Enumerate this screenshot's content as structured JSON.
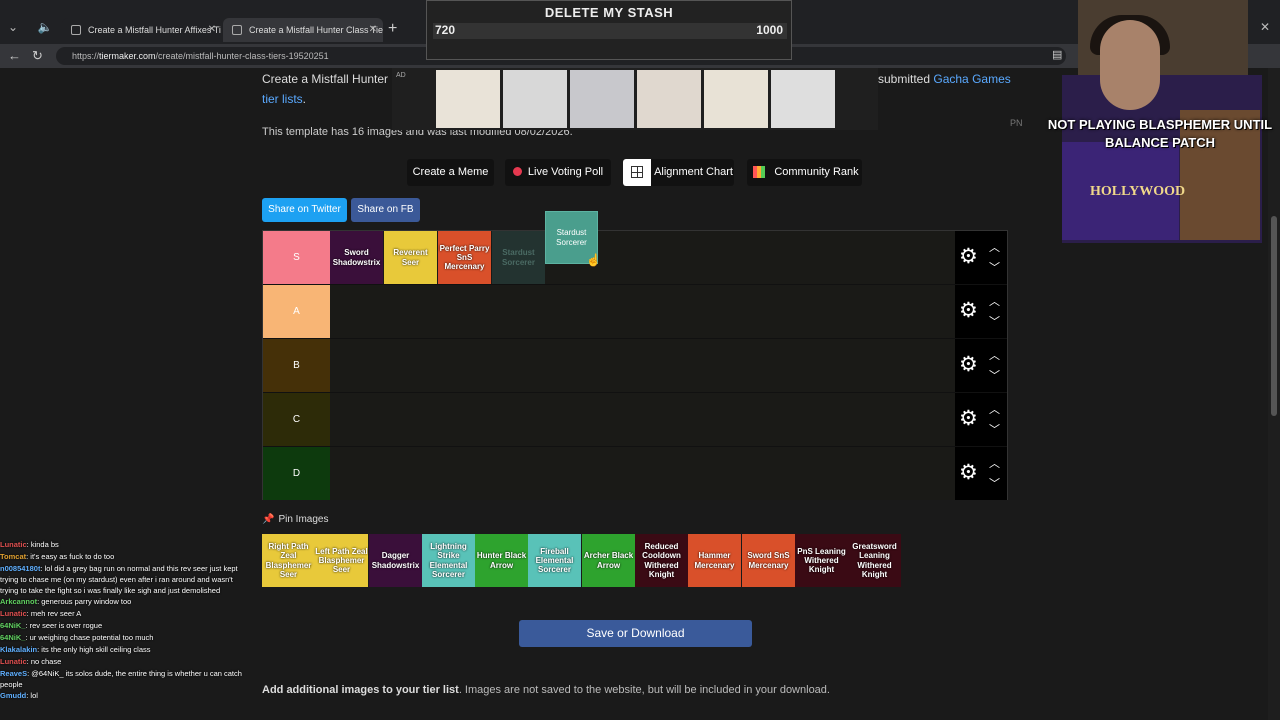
{
  "browser": {
    "tabs": [
      {
        "title": "Create a Mistfall Hunter Affixes Ti",
        "active": false
      },
      {
        "title": "Create a Mistfall Hunter Class Tie",
        "active": true
      }
    ],
    "url_prefix": "https://",
    "url_domain": "tiermaker.com",
    "url_path": "/create/mistfall-hunter-class-tiers-19520251"
  },
  "page": {
    "intro_text": "Create a Mistfall Hunter C",
    "submitted_text": "submitted",
    "category_link": "Gacha Games",
    "tier_lists_link": "tier lists",
    "template_info": "This template has 16 images and was last modified 08/02/2026.",
    "ad_label": "AD",
    "pn_label": "PN",
    "buttons": {
      "create_meme": "Create a Meme",
      "live_voting": "Live Voting Poll",
      "alignment_chart": "Alignment Chart",
      "community_rank": "Community Rank"
    },
    "share": {
      "twitter": "Share on Twitter",
      "facebook": "Share on FB"
    },
    "tiers": [
      {
        "label": "S",
        "color": "#f47b8a"
      },
      {
        "label": "A",
        "color": "#f8b575"
      },
      {
        "label": "B",
        "color": "#453008"
      },
      {
        "label": "C",
        "color": "#2d2b08"
      },
      {
        "label": "D",
        "color": "#0d3a0d"
      }
    ],
    "s_tier_items": [
      {
        "label": "Sword Shadowstrix",
        "color": "#3a0f3a"
      },
      {
        "label": "Reverent Seer",
        "color": "#e8c93a"
      },
      {
        "label": "Perfect Parry SnS Mercenary",
        "color": "#d9502a"
      },
      {
        "label": "Stardust Sorcerer",
        "color": "#233330"
      }
    ],
    "dragging_item": "Stardust Sorcerer",
    "pin_images": "Pin Images",
    "pool_items": [
      {
        "label": "Right Path Zeal Blasphemer Seer",
        "color": "#e8c93a"
      },
      {
        "label": "Left Path Zeal Blasphemer Seer",
        "color": "#e8c93a"
      },
      {
        "label": "Dagger Shadowstrix",
        "color": "#3a0f3a"
      },
      {
        "label": "Lightning Strike Elemental Sorcerer",
        "color": "#59c2b8"
      },
      {
        "label": "Hunter Black Arrow",
        "color": "#2ea32e"
      },
      {
        "label": "Fireball Elemental Sorcerer",
        "color": "#59c2b8"
      },
      {
        "label": "Archer Black Arrow",
        "color": "#2ea32e"
      },
      {
        "label": "Reduced Cooldown Withered Knight",
        "color": "#3a0a14"
      },
      {
        "label": "Hammer Mercenary",
        "color": "#d9502a"
      },
      {
        "label": "Sword SnS Mercenary",
        "color": "#d9502a"
      },
      {
        "label": "PnS Leaning Withered Knight",
        "color": "#3a0a14"
      },
      {
        "label": "Greatsword Leaning Withered Knight",
        "color": "#3a0a14"
      }
    ],
    "save_button": "Save or Download",
    "add_images_bold": "Add additional images to your tier list",
    "add_images_rest": ". Images are not saved to the website, but will be included in your download."
  },
  "overlays": {
    "stash_title": "DELETE MY STASH",
    "stash_left": "720",
    "stash_right": "1000",
    "streamer_text": "NOT PLAYING BLASPHEMER UNTIL BALANCE PATCH",
    "ad_brand": "HOLLYWOOD"
  },
  "chat": [
    {
      "user": "Lunatic",
      "text": ": kinda bs",
      "color": "#e05050"
    },
    {
      "user": "Tomcat",
      "text": ": it's easy as fuck to do too",
      "color": "#e0a030"
    },
    {
      "user": "n00854180t",
      "text": ": lol did a grey bag run on normal and this rev seer just kept trying to chase me (on my stardust) even after i ran around and wasn't trying to take the fight so i was finally like sigh and just demolished",
      "color": "#60b0ff"
    },
    {
      "user": "Arkcannot",
      "text": ": generous parry window too",
      "color": "#60d060"
    },
    {
      "user": "Lunatic",
      "text": ": meh rev seer A",
      "color": "#e05050"
    },
    {
      "user": "64NiK_",
      "text": ": rev seer is over rogue",
      "color": "#60d060"
    },
    {
      "user": "64NiK_",
      "text": ": ur weighing chase potential too much",
      "color": "#60d060"
    },
    {
      "user": "Klakalakin",
      "text": ": its the only high skill ceiling class",
      "color": "#60b0ff"
    },
    {
      "user": "Lunatic",
      "text": ": no chase",
      "color": "#e05050"
    },
    {
      "user": "ReaveS",
      "text": ": @64NiK_ its solos dude, the entire thing is whether u can catch people",
      "color": "#60b0ff"
    },
    {
      "user": "Gmudd",
      "text": ": lol",
      "color": "#60b0ff"
    }
  ]
}
